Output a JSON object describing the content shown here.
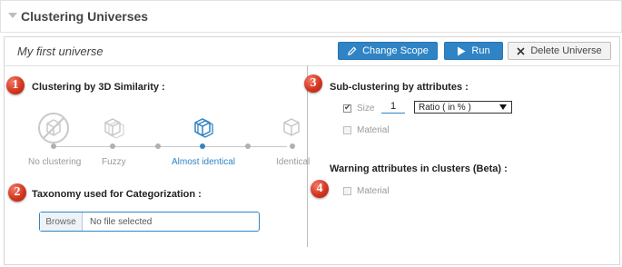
{
  "header": {
    "title": "Clustering Universes"
  },
  "universe": {
    "name": "My first universe"
  },
  "toolbar": {
    "change_scope_label": "Change Scope",
    "run_label": "Run",
    "delete_label": "Delete Universe",
    "accent_color": "#2f84c5"
  },
  "sections": {
    "similarity": {
      "number": "1",
      "title": "Clustering by 3D Similarity :"
    },
    "taxonomy": {
      "number": "2",
      "title": "Taxonomy used for Categorization :"
    },
    "subclustering": {
      "number": "3",
      "title": "Sub-clustering by attributes :"
    },
    "warning": {
      "number": "4",
      "title": "Warning attributes in clusters (Beta) :"
    }
  },
  "similarity_options": [
    {
      "label": "No clustering",
      "icon": "no-clustering-icon",
      "selected": false
    },
    {
      "label": "Fuzzy",
      "icon": "fuzzy-cube-icon",
      "selected": false
    },
    {
      "label": "Almost identical",
      "icon": "almost-identical-cube-icon",
      "selected": true
    },
    {
      "label": "Identical",
      "icon": "identical-cube-icon",
      "selected": false
    }
  ],
  "taxonomy_file": {
    "browse_label": "Browse",
    "status": "No file selected"
  },
  "subclustering_attributes": {
    "size": {
      "label": "Size",
      "checked": true,
      "value": "1",
      "unit": "Ratio ( in % )"
    },
    "material": {
      "label": "Material",
      "checked": false
    }
  },
  "warning_attributes": {
    "material": {
      "label": "Material",
      "checked": false
    }
  },
  "badge_color": "#d43620"
}
